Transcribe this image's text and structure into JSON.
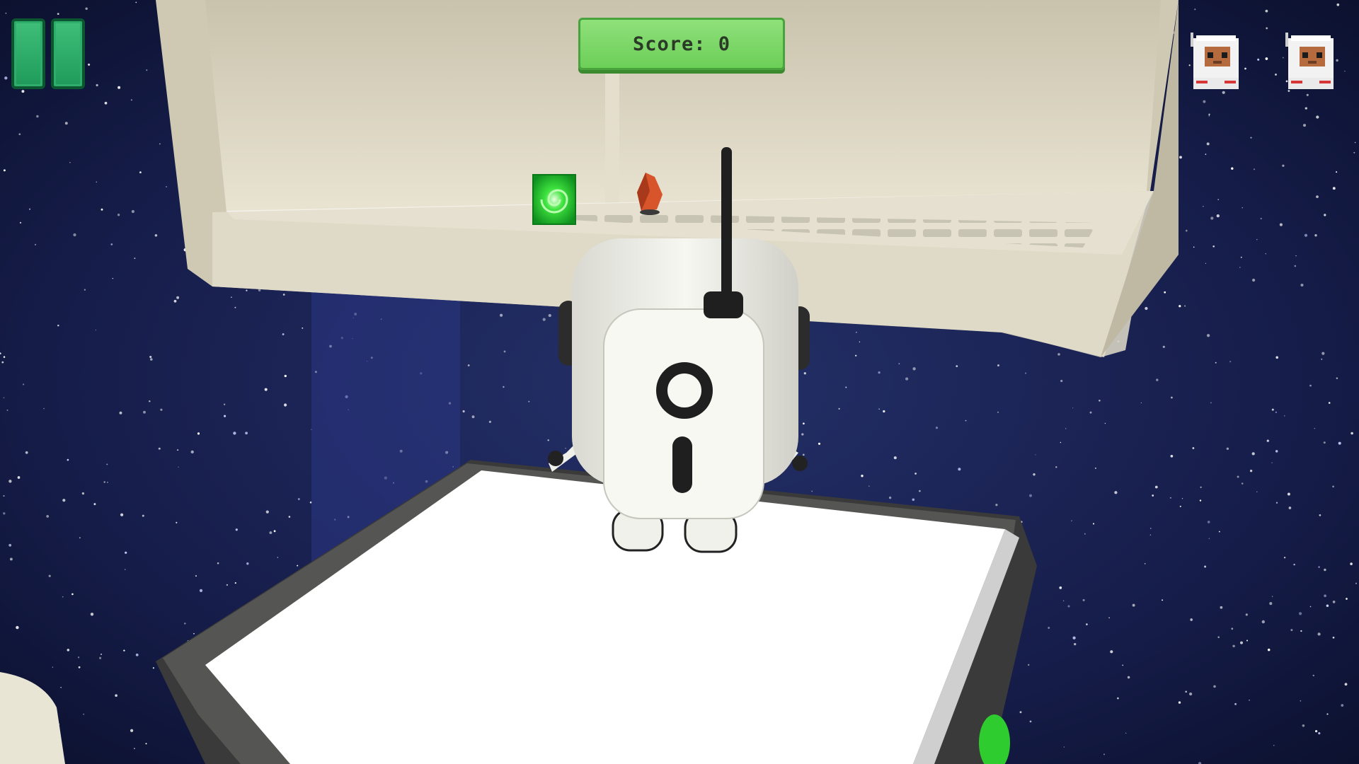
{
  "hud": {
    "score_label": "Score: 0",
    "pause_icon": "pause-icon",
    "lives_icon": "astronaut-life-icon",
    "lives": 2
  },
  "colors": {
    "space": "#1a2150",
    "platform": "#ffffff",
    "platform_rim": "#3a3a3a",
    "shelf": "#d8d2c0",
    "hud_green": "#76d862",
    "pause_green": "#2fae6b",
    "portal": "#2bd62b",
    "crystal": "#d8542a"
  }
}
